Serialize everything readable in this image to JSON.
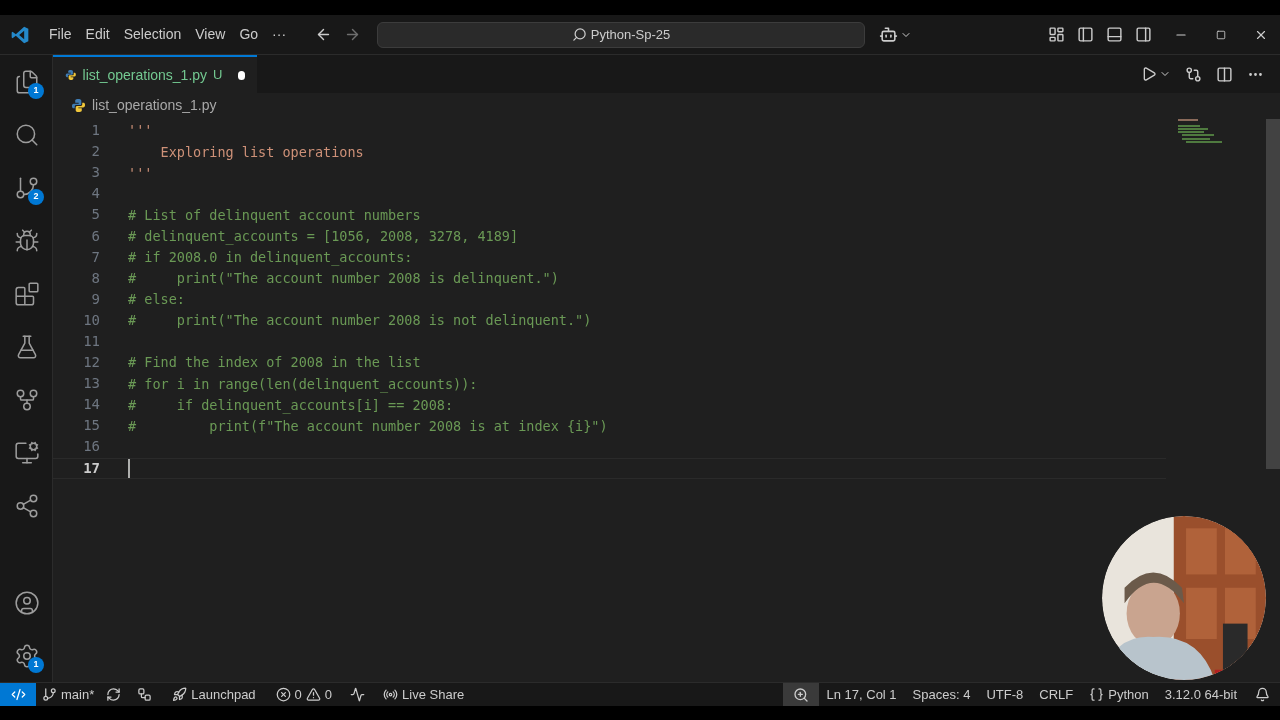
{
  "menu": [
    "File",
    "Edit",
    "Selection",
    "View",
    "Go",
    "···"
  ],
  "search": {
    "value": "Python-Sp-25"
  },
  "tabs": [
    {
      "label": "list_operations_1.py",
      "status": "U",
      "modified": true,
      "selected": true
    }
  ],
  "breadcrumb": "list_operations_1.py",
  "activity": [
    {
      "kind": "files",
      "badge": "1",
      "selected": false
    },
    {
      "kind": "search",
      "selected": false
    },
    {
      "kind": "git",
      "badge": "2",
      "selected": false
    },
    {
      "kind": "debug",
      "selected": false
    },
    {
      "kind": "extensions",
      "selected": false
    },
    {
      "kind": "flask",
      "selected": false
    },
    {
      "kind": "gitgraph",
      "selected": false
    },
    {
      "kind": "remote",
      "selected": false
    },
    {
      "kind": "share",
      "selected": false
    }
  ],
  "bottom_activity": [
    {
      "kind": "account"
    },
    {
      "kind": "settings",
      "badge": "1"
    }
  ],
  "lines": [
    {
      "number": "1",
      "kind": "string",
      "text": "'''",
      "current": false
    },
    {
      "number": "2",
      "kind": "string",
      "text": "    Exploring list operations",
      "current": false
    },
    {
      "number": "3",
      "kind": "string",
      "text": "'''",
      "current": false
    },
    {
      "number": "4",
      "current": false
    },
    {
      "number": "5",
      "kind": "comment",
      "text": "# List of delinquent account numbers",
      "current": false
    },
    {
      "number": "6",
      "kind": "comment",
      "text": "# delinquent_accounts = [1056, 2008, 3278, 4189]",
      "current": false
    },
    {
      "number": "7",
      "kind": "comment",
      "text": "# if 2008.0 in delinquent_accounts:",
      "current": false
    },
    {
      "number": "8",
      "kind": "comment",
      "text": "#     print(\"The account number 2008 is delinquent.\")",
      "current": false
    },
    {
      "number": "9",
      "kind": "comment",
      "text": "# else:",
      "current": false
    },
    {
      "number": "10",
      "kind": "comment",
      "text": "#     print(\"The account number 2008 is not delinquent.\")",
      "current": false
    },
    {
      "number": "11",
      "current": false
    },
    {
      "number": "12",
      "kind": "comment",
      "text": "# Find the index of 2008 in the list",
      "current": false
    },
    {
      "number": "13",
      "kind": "comment",
      "text": "# for i in range(len(delinquent_accounts)):",
      "current": false
    },
    {
      "number": "14",
      "kind": "comment",
      "text": "#     if delinquent_accounts[i] == 2008:",
      "current": false
    },
    {
      "number": "15",
      "kind": "comment",
      "text": "#         print(f\"The account number 2008 is at index {i}\")",
      "current": false
    },
    {
      "number": "16",
      "current": false
    },
    {
      "number": "17",
      "current": true
    }
  ],
  "status_left": [
    {
      "kind": "remote"
    },
    {
      "kind": "branch",
      "label": "main*"
    },
    {
      "kind": "sync"
    },
    {
      "kind": "graph"
    },
    {
      "kind": "launchpad",
      "label": "Launchpad"
    },
    {
      "kind": "problems",
      "errors": "0",
      "warnings": "0"
    },
    {
      "kind": "run"
    },
    {
      "kind": "liveshare",
      "label": "Live Share"
    }
  ],
  "status_right": [
    {
      "kind": "zoom"
    },
    {
      "kind": "text",
      "label": "Ln 17, Col 1"
    },
    {
      "kind": "text",
      "label": "Spaces: 4"
    },
    {
      "kind": "text",
      "label": "UTF-8"
    },
    {
      "kind": "text",
      "label": "CRLF"
    },
    {
      "kind": "language",
      "label": "Python"
    },
    {
      "kind": "text",
      "label": "3.12.0 64-bit"
    },
    {
      "kind": "bell"
    }
  ]
}
